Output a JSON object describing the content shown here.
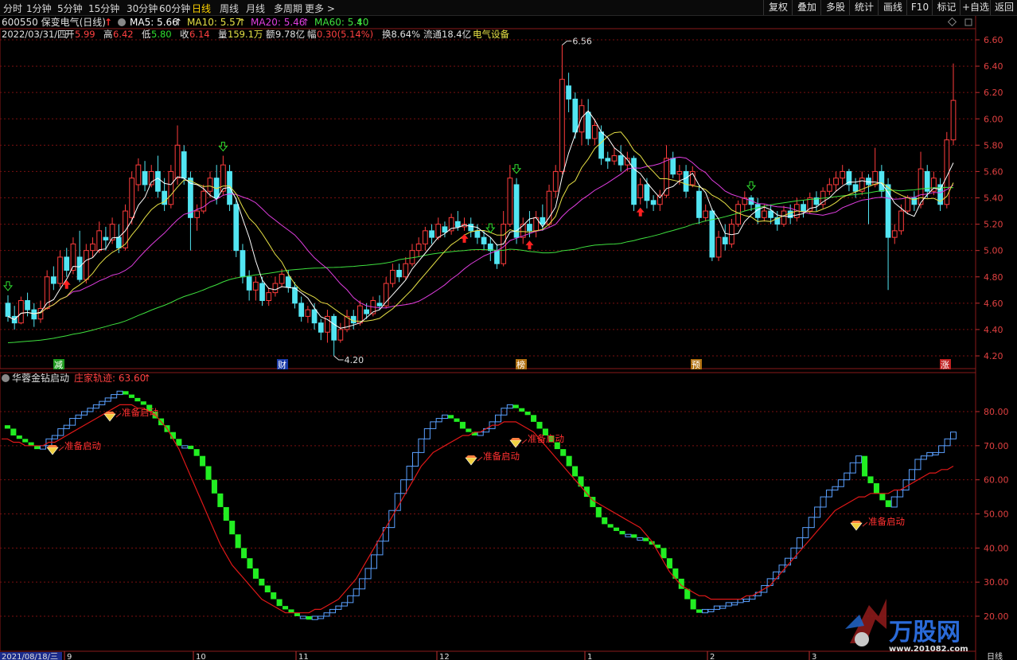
{
  "colors": {
    "up": "#ff3c3c",
    "down": "#52e5f2",
    "ma5": "#ffffff",
    "ma10": "#e6e045",
    "ma20": "#e03ee0",
    "ma60": "#3ee03e",
    "grid": "#7a1010",
    "frame": "#8a1a1a",
    "trace": "#e01818",
    "green_block": "#22ee22",
    "blue_block": "#5aa0ff",
    "gold": "#f0d040"
  },
  "timeframes": [
    {
      "label": "分时",
      "active": false
    },
    {
      "label": "1分钟",
      "active": false
    },
    {
      "label": "5分钟",
      "active": false
    },
    {
      "label": "15分钟",
      "active": false
    },
    {
      "label": "30分钟",
      "active": false
    },
    {
      "label": "60分钟",
      "active": false
    },
    {
      "label": "日线",
      "active": true
    },
    {
      "label": "周线",
      "active": false
    },
    {
      "label": "月线",
      "active": false
    },
    {
      "label": "多周期",
      "active": false
    },
    {
      "label": "更多 >",
      "active": false
    }
  ],
  "toolbar": [
    "复权",
    "叠加",
    "多股",
    "统计",
    "画线",
    "F10",
    "标记",
    "+自选",
    "返回"
  ],
  "stock": {
    "code": "600550",
    "name": "保变电气",
    "period": "(日线)"
  },
  "ma_legend": [
    {
      "label": "MA5: 5.66",
      "color": "#ffffff"
    },
    {
      "label": "MA10: 5.57",
      "color": "#e6e045"
    },
    {
      "label": "MA20: 5.46",
      "color": "#e03ee0"
    },
    {
      "label": "MA60: 5.40",
      "color": "#3ee03e"
    }
  ],
  "quote": {
    "date": "2022/03/31/四",
    "open_label": "开",
    "open": "5.99",
    "high_label": "高",
    "high": "6.42",
    "low_label": "低",
    "low": "5.80",
    "close_label": "收",
    "close": "6.14",
    "vol_label": "量",
    "vol": "159.1万",
    "amt_label": "额",
    "amt": "9.78亿",
    "chg_label": "幅",
    "chg": "0.30(5.14%)",
    "turnover": "换8.64%",
    "float": "流通18.4亿",
    "sector": "电气设备"
  },
  "price_axis": [
    "6.60",
    "6.40",
    "6.20",
    "6.00",
    "5.80",
    "5.60",
    "5.40",
    "5.20",
    "5.00",
    "4.80",
    "4.60",
    "4.40",
    "4.20"
  ],
  "annotations": {
    "high": "6.56",
    "low": "4.20"
  },
  "event_markers": [
    {
      "label": "减",
      "bg": "#1e9a1e",
      "color": "#ffffff"
    },
    {
      "label": "财",
      "bg": "#1a3aa8",
      "color": "#ffffff"
    },
    {
      "label": "榜",
      "bg": "#b07010",
      "color": "#ffffff"
    },
    {
      "label": "预",
      "bg": "#b07010",
      "color": "#ffffff"
    },
    {
      "label": "涨",
      "bg": "#c02020",
      "color": "#ffffff"
    }
  ],
  "indicator": {
    "name": "华蓉金钻启动",
    "trace_label": "庄家轨迹: 63.60",
    "signal_label": "准备启动",
    "axis": [
      "80.00",
      "70.00",
      "60.00",
      "50.00",
      "40.00",
      "30.00",
      "20.00"
    ]
  },
  "date_axis": {
    "first": "2021/08/18/三",
    "months": [
      "9",
      "10",
      "11",
      "12",
      "1",
      "2",
      "3"
    ],
    "period_label": "日线"
  },
  "watermark": {
    "brand": "万股网",
    "url": "www.201082.com"
  },
  "chart_data": {
    "type": "candlestick",
    "title": "",
    "ylim": [
      4.2,
      6.6
    ],
    "candles": [
      [
        4.6,
        4.5,
        4.66,
        4.46
      ],
      [
        4.5,
        4.45,
        4.58,
        4.4
      ],
      [
        4.45,
        4.62,
        4.65,
        4.44
      ],
      [
        4.62,
        4.55,
        4.68,
        4.5
      ],
      [
        4.55,
        4.48,
        4.6,
        4.42
      ],
      [
        4.48,
        4.56,
        4.62,
        4.45
      ],
      [
        4.56,
        4.8,
        4.85,
        4.55
      ],
      [
        4.8,
        4.75,
        4.88,
        4.7
      ],
      [
        4.75,
        4.95,
        5.0,
        4.72
      ],
      [
        4.95,
        4.85,
        5.02,
        4.8
      ],
      [
        4.85,
        5.05,
        5.1,
        4.82
      ],
      [
        4.95,
        4.78,
        5.15,
        4.76
      ],
      [
        4.78,
        5.0,
        5.05,
        4.75
      ],
      [
        5.0,
        5.05,
        5.1,
        4.95
      ],
      [
        5.0,
        5.15,
        5.22,
        4.98
      ],
      [
        5.1,
        5.08,
        5.18,
        5.0
      ],
      [
        5.08,
        5.2,
        5.25,
        5.05
      ],
      [
        5.1,
        5.02,
        5.2,
        4.98
      ],
      [
        5.02,
        5.3,
        5.35,
        5.0
      ],
      [
        5.25,
        5.55,
        5.6,
        5.2
      ],
      [
        5.5,
        5.65,
        5.7,
        5.45
      ],
      [
        5.6,
        5.5,
        5.68,
        5.45
      ],
      [
        5.5,
        5.6,
        5.65,
        5.48
      ],
      [
        5.6,
        5.45,
        5.72,
        5.4
      ],
      [
        5.45,
        5.35,
        5.55,
        5.3
      ],
      [
        5.35,
        5.6,
        5.65,
        5.32
      ],
      [
        5.55,
        5.8,
        5.95,
        5.5
      ],
      [
        5.75,
        5.55,
        5.8,
        5.5
      ],
      [
        5.55,
        5.25,
        5.6,
        5.0
      ],
      [
        5.25,
        5.3,
        5.35,
        5.15
      ],
      [
        5.3,
        5.45,
        5.5,
        5.28
      ],
      [
        5.45,
        5.55,
        5.6,
        5.4
      ],
      [
        5.55,
        5.4,
        5.65,
        5.35
      ],
      [
        5.45,
        5.65,
        5.72,
        5.42
      ],
      [
        5.6,
        5.35,
        5.65,
        5.3
      ],
      [
        5.35,
        5.0,
        5.4,
        4.95
      ],
      [
        5.0,
        4.8,
        5.05,
        4.75
      ],
      [
        4.8,
        4.7,
        4.85,
        4.62
      ],
      [
        4.7,
        4.76,
        4.8,
        4.62
      ],
      [
        4.75,
        4.62,
        4.8,
        4.58
      ],
      [
        4.62,
        4.68,
        4.72,
        4.58
      ],
      [
        4.68,
        4.75,
        4.8,
        4.65
      ],
      [
        4.75,
        4.82,
        4.86,
        4.72
      ],
      [
        4.8,
        4.72,
        4.85,
        4.68
      ],
      [
        4.72,
        4.6,
        4.76,
        4.56
      ],
      [
        4.6,
        4.5,
        4.65,
        4.46
      ],
      [
        4.5,
        4.55,
        4.58,
        4.45
      ],
      [
        4.55,
        4.45,
        4.6,
        4.4
      ],
      [
        4.45,
        4.38,
        4.48,
        4.32
      ],
      [
        4.38,
        4.5,
        4.55,
        4.3
      ],
      [
        4.5,
        4.32,
        4.52,
        4.2
      ],
      [
        4.32,
        4.4,
        4.45,
        4.3
      ],
      [
        4.4,
        4.5,
        4.55,
        4.38
      ],
      [
        4.5,
        4.45,
        4.55,
        4.4
      ],
      [
        4.45,
        4.58,
        4.62,
        4.43
      ],
      [
        4.55,
        4.52,
        4.6,
        4.48
      ],
      [
        4.52,
        4.62,
        4.65,
        4.5
      ],
      [
        4.6,
        4.58,
        4.66,
        4.55
      ],
      [
        4.58,
        4.75,
        4.8,
        4.56
      ],
      [
        4.75,
        4.85,
        4.9,
        4.72
      ],
      [
        4.85,
        4.8,
        4.9,
        4.76
      ],
      [
        4.8,
        4.9,
        4.95,
        4.78
      ],
      [
        4.9,
        5.0,
        5.05,
        4.88
      ],
      [
        5.0,
        5.05,
        5.1,
        4.95
      ],
      [
        5.05,
        5.15,
        5.18,
        5.0
      ],
      [
        5.15,
        5.1,
        5.2,
        5.05
      ],
      [
        5.1,
        5.2,
        5.25,
        5.08
      ],
      [
        5.18,
        5.14,
        5.22,
        5.1
      ],
      [
        5.15,
        5.25,
        5.28,
        5.12
      ],
      [
        5.22,
        5.18,
        5.3,
        5.15
      ],
      [
        5.18,
        5.2,
        5.25,
        5.15
      ],
      [
        5.2,
        5.15,
        5.25,
        5.1
      ],
      [
        5.15,
        5.1,
        5.2,
        5.05
      ],
      [
        5.1,
        5.05,
        5.15,
        5.0
      ],
      [
        5.05,
        5.0,
        5.1,
        4.92
      ],
      [
        5.0,
        4.9,
        5.05,
        4.86
      ],
      [
        4.9,
        5.2,
        5.3,
        4.88
      ],
      [
        5.2,
        5.55,
        5.65,
        5.18
      ],
      [
        5.5,
        5.1,
        5.55,
        5.05
      ],
      [
        5.1,
        5.2,
        5.25,
        5.05
      ],
      [
        5.2,
        5.15,
        5.3,
        5.1
      ],
      [
        5.15,
        5.25,
        5.3,
        5.1
      ],
      [
        5.25,
        5.2,
        5.35,
        5.15
      ],
      [
        5.2,
        5.45,
        5.5,
        5.18
      ],
      [
        5.45,
        5.6,
        5.65,
        5.4
      ],
      [
        5.6,
        6.3,
        6.56,
        5.58
      ],
      [
        6.25,
        6.15,
        6.35,
        6.05
      ],
      [
        6.15,
        5.9,
        6.2,
        5.85
      ],
      [
        5.9,
        6.1,
        6.15,
        5.8
      ],
      [
        6.05,
        5.85,
        6.15,
        5.8
      ],
      [
        5.85,
        5.95,
        6.0,
        5.8
      ],
      [
        5.9,
        5.7,
        5.95,
        5.65
      ],
      [
        5.7,
        5.68,
        5.75,
        5.62
      ],
      [
        5.68,
        5.72,
        5.78,
        5.65
      ],
      [
        5.72,
        5.65,
        5.8,
        5.6
      ],
      [
        5.65,
        5.7,
        5.75,
        5.6
      ],
      [
        5.7,
        5.35,
        5.72,
        5.3
      ],
      [
        5.4,
        5.5,
        5.55,
        5.35
      ],
      [
        5.5,
        5.38,
        5.55,
        5.32
      ],
      [
        5.38,
        5.35,
        5.42,
        5.3
      ],
      [
        5.35,
        5.42,
        5.46,
        5.3
      ],
      [
        5.42,
        5.7,
        5.8,
        5.4
      ],
      [
        5.7,
        5.58,
        5.75,
        5.55
      ],
      [
        5.58,
        5.6,
        5.65,
        5.5
      ],
      [
        5.6,
        5.45,
        5.65,
        5.4
      ],
      [
        5.5,
        5.6,
        5.64,
        5.48
      ],
      [
        5.45,
        5.25,
        5.5,
        5.2
      ],
      [
        5.25,
        5.3,
        5.35,
        5.22
      ],
      [
        5.3,
        4.95,
        5.32,
        4.92
      ],
      [
        4.95,
        5.1,
        5.15,
        4.92
      ],
      [
        5.1,
        5.05,
        5.2,
        5.0
      ],
      [
        5.05,
        5.2,
        5.24,
        5.02
      ],
      [
        5.2,
        5.35,
        5.38,
        5.18
      ],
      [
        5.35,
        5.4,
        5.45,
        5.3
      ],
      [
        5.4,
        5.35,
        5.42,
        5.3
      ],
      [
        5.35,
        5.25,
        5.4,
        5.2
      ],
      [
        5.25,
        5.3,
        5.35,
        5.22
      ],
      [
        5.3,
        5.25,
        5.35,
        5.2
      ],
      [
        5.25,
        5.2,
        5.3,
        5.15
      ],
      [
        5.2,
        5.3,
        5.34,
        5.18
      ],
      [
        5.3,
        5.25,
        5.35,
        5.2
      ],
      [
        5.25,
        5.35,
        5.4,
        5.22
      ],
      [
        5.35,
        5.3,
        5.38,
        5.25
      ],
      [
        5.3,
        5.4,
        5.44,
        5.28
      ],
      [
        5.4,
        5.35,
        5.45,
        5.3
      ],
      [
        5.35,
        5.45,
        5.48,
        5.32
      ],
      [
        5.45,
        5.5,
        5.55,
        5.42
      ],
      [
        5.5,
        5.55,
        5.6,
        5.45
      ],
      [
        5.55,
        5.6,
        5.65,
        5.5
      ],
      [
        5.6,
        5.5,
        5.62,
        5.45
      ],
      [
        5.5,
        5.45,
        5.55,
        5.4
      ],
      [
        5.45,
        5.55,
        5.6,
        5.42
      ],
      [
        5.55,
        5.5,
        5.58,
        5.2
      ],
      [
        5.5,
        5.6,
        5.78,
        5.48
      ],
      [
        5.6,
        5.45,
        5.65,
        5.4
      ],
      [
        5.5,
        5.1,
        5.55,
        4.7
      ],
      [
        5.1,
        5.15,
        5.2,
        5.05
      ],
      [
        5.15,
        5.3,
        5.35,
        5.12
      ],
      [
        5.3,
        5.4,
        5.42,
        5.28
      ],
      [
        5.4,
        5.35,
        5.45,
        5.3
      ],
      [
        5.35,
        5.62,
        5.75,
        5.32
      ],
      [
        5.6,
        5.45,
        5.65,
        5.4
      ],
      [
        5.45,
        5.55,
        5.6,
        5.42
      ],
      [
        5.5,
        5.35,
        5.55,
        5.3
      ],
      [
        5.35,
        5.84,
        5.9,
        5.32
      ],
      [
        5.84,
        6.14,
        6.42,
        5.8
      ]
    ]
  },
  "indicator_data": {
    "blocks": [
      76,
      75,
      73,
      72,
      71,
      70,
      69,
      70,
      72,
      73,
      75,
      76,
      78,
      79,
      80,
      81,
      82,
      83,
      84,
      85,
      86,
      85,
      84,
      83,
      82,
      80,
      78,
      76,
      74,
      72,
      70,
      70,
      69,
      67,
      64,
      60,
      56,
      52,
      48,
      44,
      40,
      37,
      34,
      31,
      29,
      27,
      25,
      23,
      22,
      21,
      20,
      20,
      19,
      20,
      20,
      21,
      22,
      23,
      24,
      26,
      28,
      31,
      34,
      38,
      42,
      46,
      51,
      56,
      60,
      64,
      68,
      72,
      75,
      77,
      78,
      79,
      78,
      77,
      75,
      74,
      73,
      74,
      75,
      77,
      79,
      81,
      82,
      81,
      80,
      79,
      77,
      75,
      73,
      71,
      69,
      67,
      64,
      61,
      58,
      55,
      52,
      49,
      47,
      46,
      45,
      44,
      44,
      43,
      43,
      42,
      41,
      40,
      37,
      34,
      31,
      28,
      25,
      22,
      21,
      22,
      22,
      23,
      23,
      24,
      24,
      25,
      25,
      26,
      27,
      29,
      31,
      33,
      35,
      37,
      40,
      43,
      46,
      49,
      52,
      55,
      57,
      58,
      60,
      62,
      65,
      67,
      61,
      59,
      56,
      54,
      52,
      55,
      57,
      60,
      63,
      66,
      67,
      68,
      68,
      70,
      72,
      74
    ],
    "trace": [
      72,
      72,
      71,
      71,
      70,
      70,
      70,
      70,
      71,
      71,
      72,
      73,
      74,
      75,
      76,
      77,
      78,
      79,
      80,
      81,
      82,
      82,
      82,
      81,
      81,
      80,
      79,
      77,
      75,
      72,
      69,
      65,
      61,
      57,
      53,
      49,
      45,
      41,
      38,
      35,
      33,
      31,
      29,
      27,
      25,
      24,
      23,
      22,
      21,
      21,
      21,
      21,
      21,
      22,
      22,
      23,
      24,
      25,
      27,
      29,
      31,
      34,
      37,
      40,
      43,
      46,
      49,
      52,
      55,
      58,
      61,
      64,
      66,
      68,
      69,
      70,
      71,
      72,
      73,
      73,
      74,
      74,
      75,
      76,
      76,
      77,
      77,
      77,
      76,
      75,
      74,
      72,
      70,
      68,
      66,
      64,
      62,
      60,
      58,
      56,
      54,
      53,
      52,
      51,
      50,
      49,
      48,
      47,
      46,
      44,
      42,
      39,
      36,
      33,
      31,
      29,
      28,
      27,
      26,
      26,
      25,
      25,
      25,
      25,
      25,
      25,
      26,
      26,
      27,
      28,
      29,
      31,
      33,
      35,
      37,
      39,
      41,
      43,
      45,
      47,
      49,
      51,
      52,
      53,
      54,
      55,
      55,
      56,
      56,
      56,
      56,
      57,
      57,
      58,
      59,
      60,
      61,
      62,
      62,
      63,
      63,
      64
    ]
  }
}
